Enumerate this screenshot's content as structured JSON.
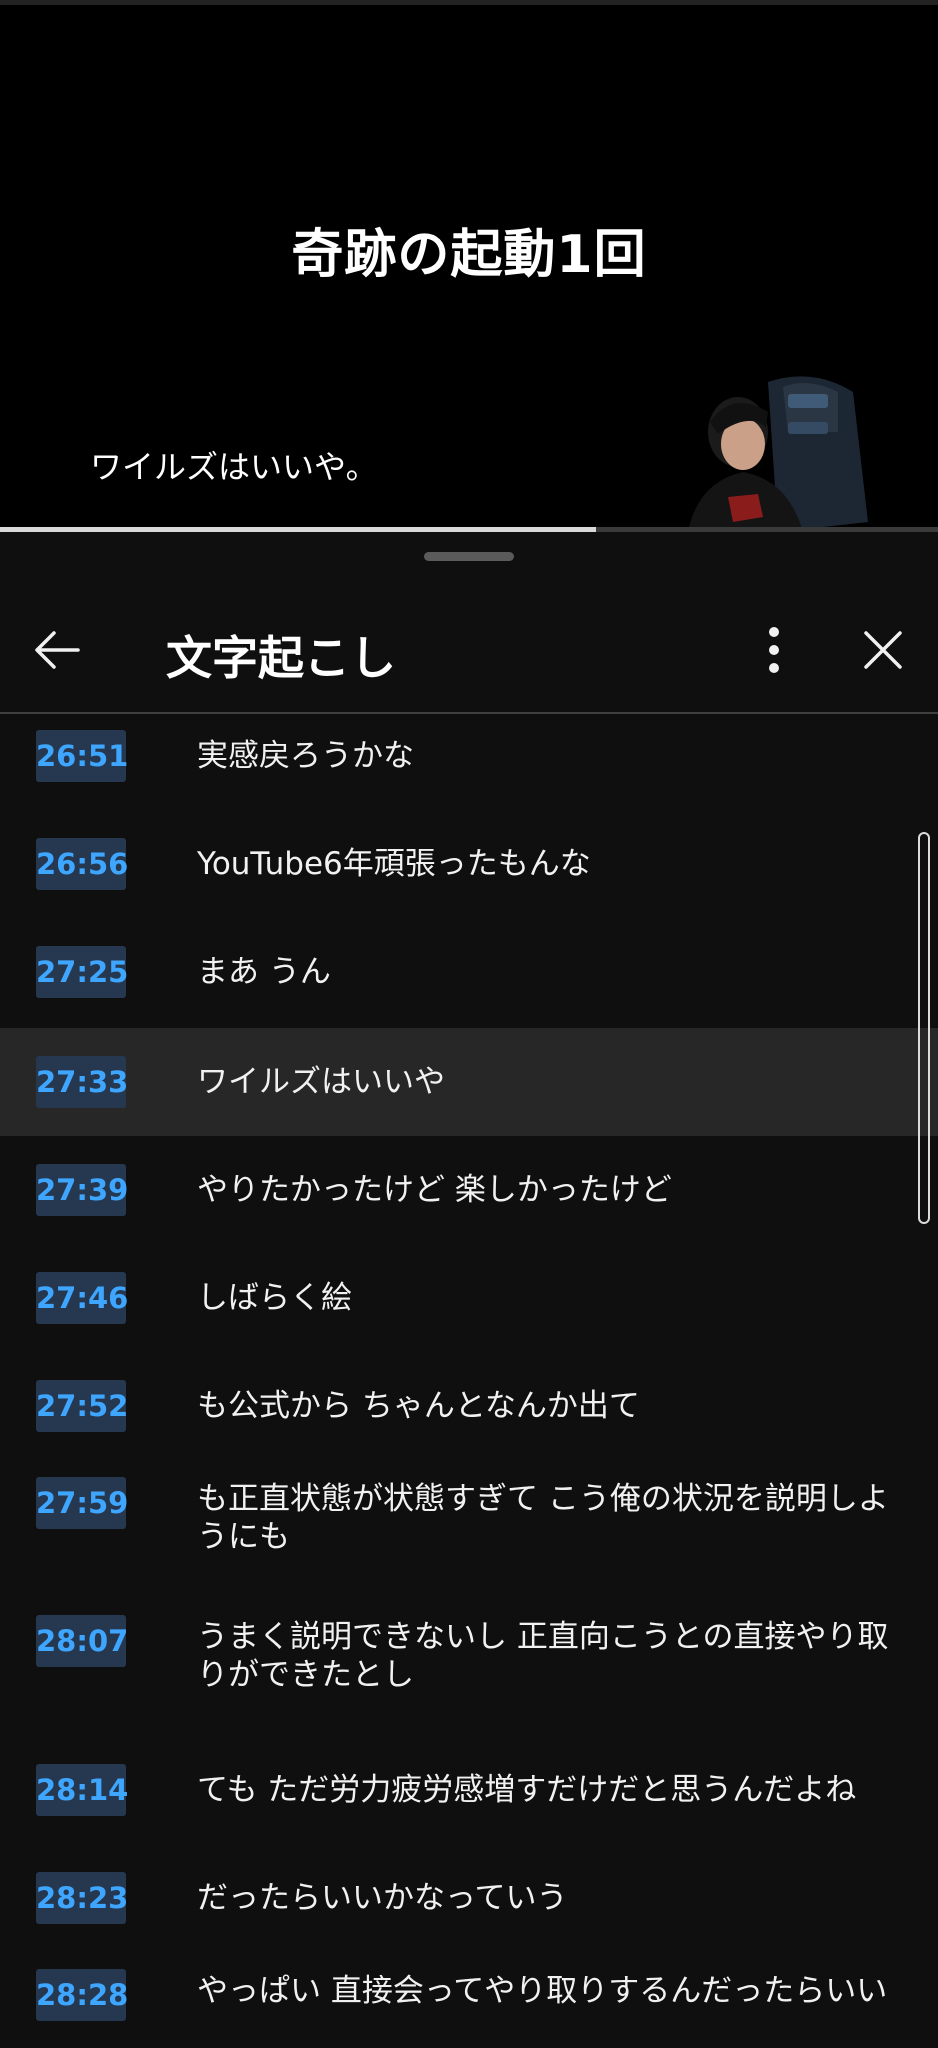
{
  "video": {
    "title": "奇跡の起動1回",
    "caption": "ワイルズはいいや。",
    "progress": 0.635
  },
  "panel": {
    "title": "文字起こし",
    "icons": {
      "back": "arrow-left-icon",
      "more": "more-vertical-icon",
      "close": "close-icon"
    }
  },
  "transcript": [
    {
      "time": "26:51",
      "text": "実感戻ろうかな"
    },
    {
      "time": "26:56",
      "text": "YouTube6年頑張ったもんな"
    },
    {
      "time": "27:25",
      "text": "まあ うん"
    },
    {
      "time": "27:33",
      "text": "ワイルズはいいや",
      "active": true
    },
    {
      "time": "27:39",
      "text": "やりたかったけど 楽しかったけど"
    },
    {
      "time": "27:46",
      "text": "しばらく絵"
    },
    {
      "time": "27:52",
      "text": "も公式から ちゃんとなんか出て"
    },
    {
      "time": "27:59",
      "text": "も正直状態が状態すぎて こう俺の状況を説明しようにも"
    },
    {
      "time": "28:07",
      "text": "うまく説明できないし 正直向こうとの直接やり取りができたとし"
    },
    {
      "time": "28:14",
      "text": "ても ただ労力疲労感増すだけだと思うんだよね"
    },
    {
      "time": "28:23",
      "text": "だったらいいかなっていう"
    },
    {
      "time": "28:28",
      "text": "やっぱい 直接会ってやり取りするんだったらいい"
    }
  ]
}
